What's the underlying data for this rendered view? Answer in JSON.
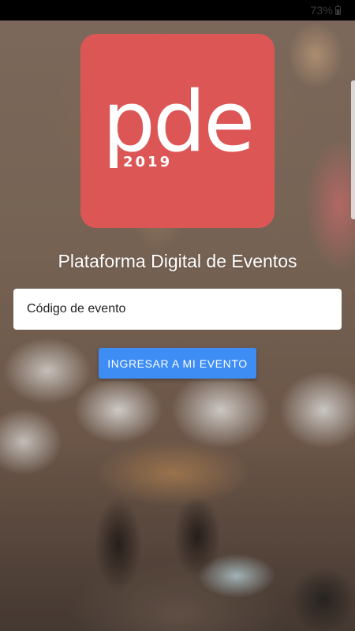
{
  "status_bar": {
    "battery_percent": "73%",
    "battery_icon": "battery-charging-icon"
  },
  "logo": {
    "brand_text": "pde",
    "year": "2019",
    "background_color": "#dd5656"
  },
  "app": {
    "title": "Plataforma Digital de Eventos"
  },
  "form": {
    "event_code_placeholder": "Código de evento",
    "event_code_value": "",
    "submit_label": "INGRESAR A MI EVENTO",
    "submit_color": "#3d8df5"
  }
}
